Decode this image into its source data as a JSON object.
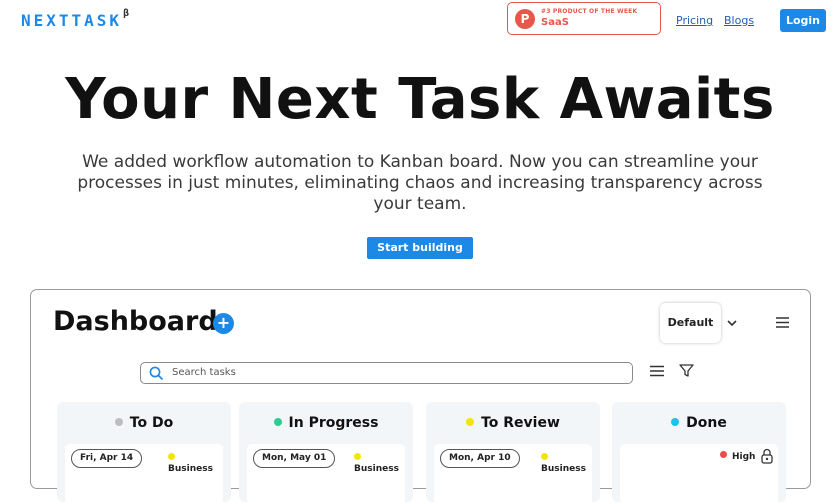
{
  "nav": {
    "logo": "NEXTTASK",
    "logo_sup": "β",
    "badge_icon": "P",
    "badge_top": "#3 PRODUCT OF THE WEEK",
    "badge_main": "SaaS",
    "links": [
      "Pricing",
      "Blogs"
    ],
    "login": "Login"
  },
  "hero": {
    "title": "Your Next Task Awaits",
    "subtitle": "We added workflow automation to Kanban board. Now you can streamline your processes in just minutes, eliminating chaos and increasing transparency across your team.",
    "cta": "Start building"
  },
  "dashboard": {
    "title": "Dashboard",
    "add": "+",
    "view_select": "Default",
    "search_placeholder": "Search tasks",
    "columns": [
      {
        "title": "To Do",
        "dot": "#bdbdbd",
        "date": "Fri, Apr 14",
        "tag": "Business",
        "tag_color": "#f2e600"
      },
      {
        "title": "In Progress",
        "dot": "#2ecc8f",
        "date": "Mon, May 01",
        "tag": "Business",
        "tag_color": "#f2e600"
      },
      {
        "title": "To Review",
        "dot": "#f2e600",
        "date": "Mon, Apr 10",
        "tag": "Business",
        "tag_color": "#f2e600"
      },
      {
        "title": "Done",
        "dot": "#1ec0ec",
        "priority": "High",
        "priority_color": "#e84c4c"
      }
    ]
  },
  "colors": {
    "accent": "#1e88e5",
    "producthunt": "#e8574a"
  }
}
